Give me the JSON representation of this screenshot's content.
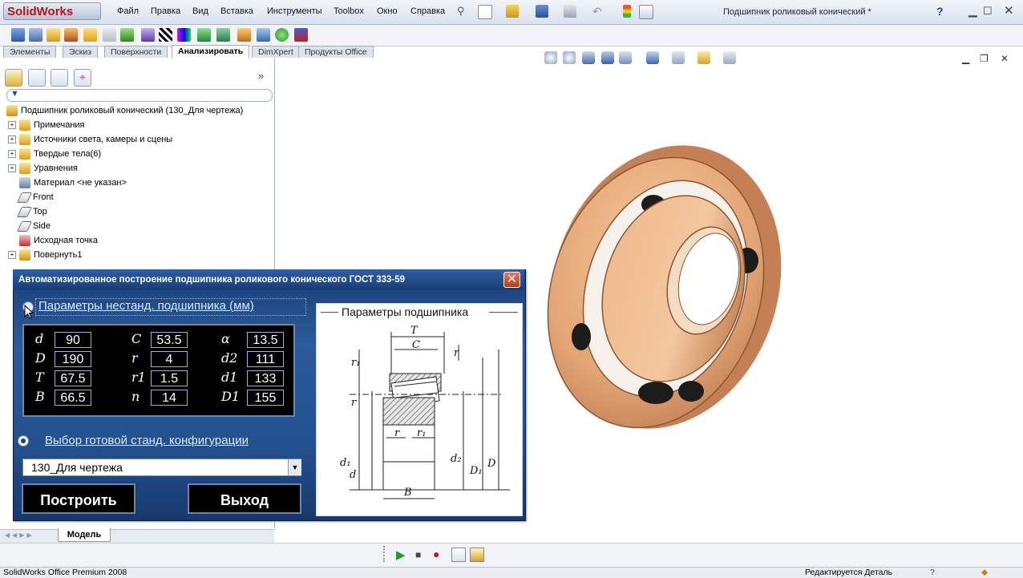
{
  "app": {
    "logo_text": "SolidWorks",
    "document_title": "Подшипник роликовый конический *",
    "menu": [
      "Файл",
      "Правка",
      "Вид",
      "Вставка",
      "Инструменты",
      "Toolbox",
      "Окно",
      "Справка"
    ]
  },
  "command_tabs": [
    "Элементы",
    "Эскиз",
    "Поверхности",
    "Анализировать",
    "DimXpert",
    "Продукты Office"
  ],
  "active_tab": "Анализировать",
  "feature_tree": {
    "root": "Подшипник роликовый конический  (130_Для чертежа)",
    "items": [
      {
        "label": "Примечания",
        "icon": "annotations-icon",
        "expandable": true
      },
      {
        "label": "Источники света, камеры и сцены",
        "icon": "lights-icon",
        "expandable": true
      },
      {
        "label": "Твердые тела(6)",
        "icon": "solid-bodies-icon",
        "expandable": true
      },
      {
        "label": "Уравнения",
        "icon": "equations-icon",
        "expandable": true
      },
      {
        "label": "Материал <не указан>",
        "icon": "material-icon",
        "expandable": false
      },
      {
        "label": "Front",
        "icon": "plane-icon",
        "expandable": false
      },
      {
        "label": "Top",
        "icon": "plane-icon",
        "expandable": false
      },
      {
        "label": "Side",
        "icon": "plane-icon",
        "expandable": false
      },
      {
        "label": "Исходная точка",
        "icon": "origin-icon",
        "expandable": false
      },
      {
        "label": "Повернуть1",
        "icon": "revolve-icon",
        "expandable": true
      }
    ]
  },
  "bottom": {
    "model_tab": "Модель",
    "status_left": "SolidWorks Office Premium 2008",
    "status_right": "Редактируется Деталь"
  },
  "dialog": {
    "title": "Автоматизированное построение  подшипника роликового конического ГОСТ 333-59",
    "option_custom": "Параметры нестанд. подшипника (мм)",
    "option_standard": "Выбор готовой станд. конфигурации",
    "selected_option": "standard",
    "params": [
      {
        "label": "d",
        "value": "90"
      },
      {
        "label": "D",
        "value": "190"
      },
      {
        "label": "T",
        "value": "67.5"
      },
      {
        "label": "B",
        "value": "66.5"
      },
      {
        "label": "C",
        "value": "53.5"
      },
      {
        "label": "r",
        "value": "4"
      },
      {
        "label": "r1",
        "value": "1.5"
      },
      {
        "label": "n",
        "value": "14"
      },
      {
        "label": "α",
        "value": "13.5"
      },
      {
        "label": "d2",
        "value": "111"
      },
      {
        "label": "d1",
        "value": "133"
      },
      {
        "label": "D1",
        "value": "155"
      }
    ],
    "config_value": "130_Для чертежа",
    "build_button": "Построить",
    "exit_button": "Выход",
    "image_title": "Параметры подшипника",
    "drawing_labels": {
      "T": "T",
      "C": "C",
      "r": "r",
      "r1": "r₁",
      "B": "B",
      "d": "d",
      "d1": "d₁",
      "d2": "d₂",
      "D1": "D₁",
      "D": "D"
    }
  },
  "colors": {
    "dialog_bg": "#23508f",
    "bearing": "#e8b07e",
    "close_button": "#c23614"
  }
}
